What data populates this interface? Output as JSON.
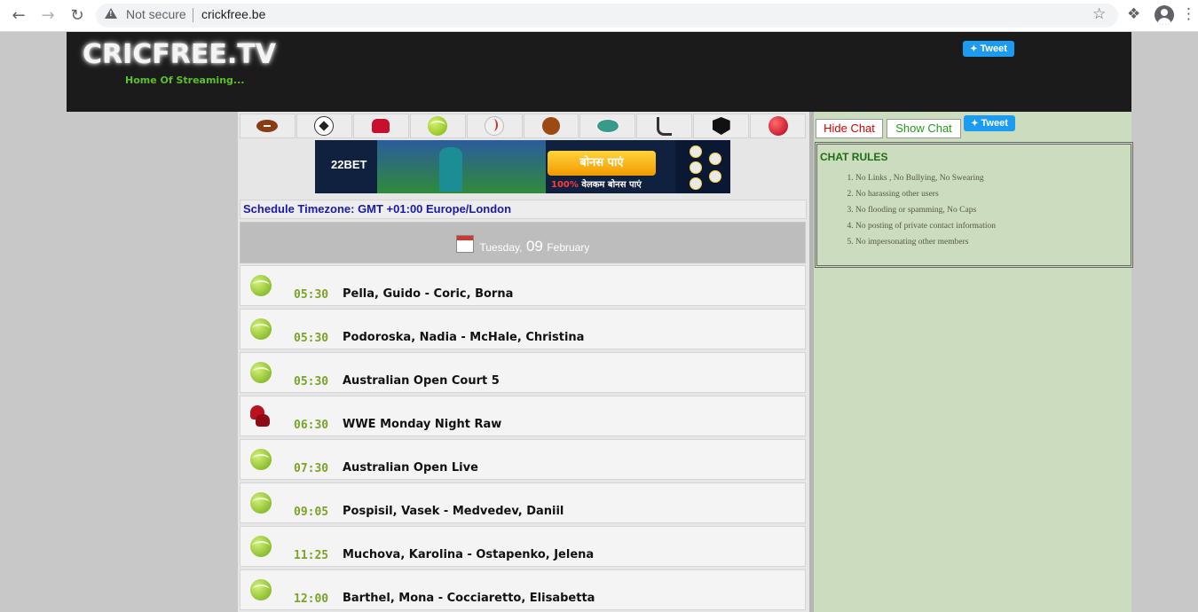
{
  "browser": {
    "security_label": "Not secure",
    "url": "crickfree.be"
  },
  "header": {
    "logo": "CRICFREE.TV",
    "tagline": "Home Of Streaming...",
    "tweet_label": "Tweet"
  },
  "sports_nav": [
    {
      "icon": "american-football-icon"
    },
    {
      "icon": "soccer-ball-icon"
    },
    {
      "icon": "boxing-gloves-icon"
    },
    {
      "icon": "tennis-ball-icon"
    },
    {
      "icon": "baseball-icon"
    },
    {
      "icon": "basketball-icon"
    },
    {
      "icon": "rugby-ball-icon"
    },
    {
      "icon": "hockey-stick-icon"
    },
    {
      "icon": "nhl-icon"
    },
    {
      "icon": "cricket-ball-icon"
    }
  ],
  "banner": {
    "brand": "22BET",
    "button_text": "बोनस पाएं",
    "sub_percent": "100%",
    "sub_text": "वेलकम बोनस पाएं"
  },
  "schedule": {
    "timezone_label": "Schedule Timezone: GMT +01:00 Europe/London",
    "date": {
      "weekday": "Tuesday,",
      "day": "09",
      "month": "February"
    },
    "events": [
      {
        "sport": "tennis",
        "time": "05:30",
        "name": "Pella, Guido - Coric, Borna"
      },
      {
        "sport": "tennis",
        "time": "05:30",
        "name": "Podoroska, Nadia - McHale, Christina"
      },
      {
        "sport": "tennis",
        "time": "05:30",
        "name": "Australian Open Court 5"
      },
      {
        "sport": "boxing",
        "time": "06:30",
        "name": "WWE Monday Night Raw"
      },
      {
        "sport": "tennis",
        "time": "07:30",
        "name": "Australian Open Live"
      },
      {
        "sport": "tennis",
        "time": "09:05",
        "name": "Pospisil, Vasek - Medvedev, Daniil"
      },
      {
        "sport": "tennis",
        "time": "11:25",
        "name": "Muchova, Karolina - Ostapenko, Jelena"
      },
      {
        "sport": "tennis",
        "time": "12:00",
        "name": "Barthel, Mona - Cocciaretto, Elisabetta"
      }
    ]
  },
  "chat": {
    "hide_label": "Hide Chat",
    "show_label": "Show Chat",
    "tweet_label": "Tweet",
    "rules_title": "CHAT RULES",
    "rules": [
      "No Links , No Bullying, No Swearing",
      "No harassing other users",
      "No flooding or spamming, No Caps",
      "No posting of private contact information",
      "No impersonating other members"
    ]
  },
  "colors": {
    "time_green": "#7aa327",
    "timezone_blue": "#1a1aa8",
    "chat_bg": "#ccdcbf",
    "header_bg": "#1b1b1b"
  }
}
